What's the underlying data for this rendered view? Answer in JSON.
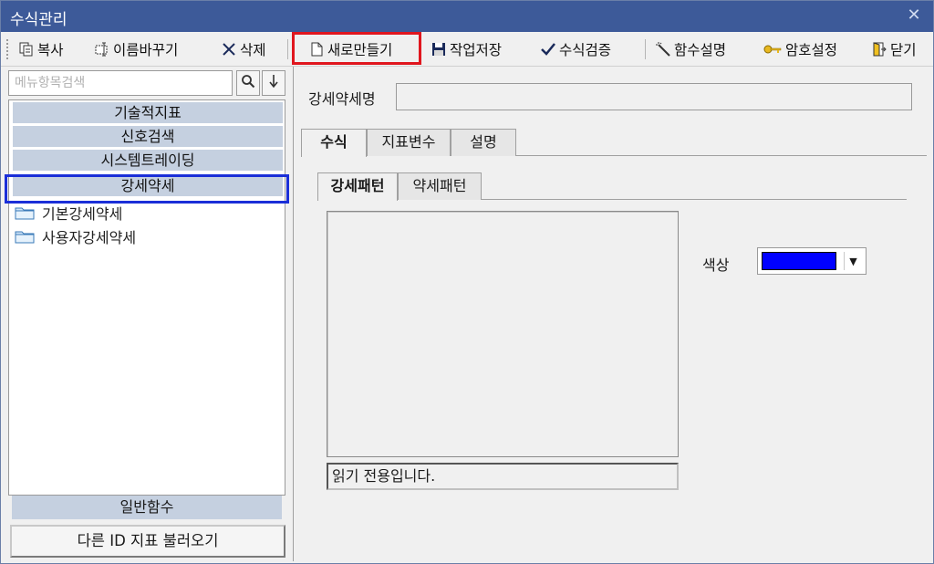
{
  "window": {
    "title": "수식관리",
    "close_glyph": "✕"
  },
  "toolbar": {
    "copy_label": "복사",
    "rename_label": "이름바꾸기",
    "delete_label": "삭제",
    "new_label": "새로만들기",
    "save_label": "작업저장",
    "verify_label": "수식검증",
    "func_desc_label": "함수설명",
    "password_label": "암호설정",
    "close_label": "닫기"
  },
  "sidebar": {
    "search_placeholder": "메뉴항목검색",
    "categories": [
      "기술적지표",
      "신호검색",
      "시스템트레이딩",
      "강세약세"
    ],
    "tree_items": [
      "기본강세약세",
      "사용자강세약세"
    ],
    "bottom_category": "일반함수",
    "load_button": "다른 ID 지표 불러오기"
  },
  "main": {
    "name_label": "강세약세명",
    "name_value": "",
    "tabs": [
      "수식",
      "지표변수",
      "설명"
    ],
    "subtabs": [
      "강세패턴",
      "약세패턴"
    ],
    "status_text": "읽기 전용입니다.",
    "color_label": "색상",
    "color_value": "#0000ff"
  },
  "colors": {
    "titlebar": "#3d5a99",
    "category_bg": "#c5d0e0",
    "highlight_red": "#e0161e",
    "highlight_blue": "#1b2fd8"
  }
}
